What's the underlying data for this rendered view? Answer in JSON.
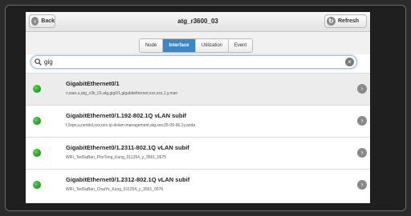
{
  "header": {
    "back_label": "Back",
    "title": "atg_r3600_03",
    "refresh_label": "Refresh"
  },
  "tabs": [
    {
      "label": "Node",
      "active": false
    },
    {
      "label": "Interface",
      "active": true
    },
    {
      "label": "Utilization",
      "active": false
    },
    {
      "label": "Event",
      "active": false
    }
  ],
  "search": {
    "value": "gig"
  },
  "interfaces": [
    {
      "name": "GigabitEthernet0/1",
      "description": "n,wan,u,atg_c3k_01,atg,gig0/1,gigabitethernet,xxx,xxx,1,y,man",
      "status": "up"
    },
    {
      "name": "GigabitEthernet0/1.192-802.1Q vLAN subif",
      "description": "f,0vpn,u,neodsl,xxx,nec-ip-dslam-management,atg,xxx,05-09-96,1y,anda",
      "status": "up"
    },
    {
      "name": "GigabitEthernet0/1.2311-802.1Q vLAN subif",
      "description": "WiFi_TedSaBan_PhoTong_Kung_011254_y_3561_0675",
      "status": "up"
    },
    {
      "name": "GigabitEthernet0/1.2312-802.1Q vLAN subif",
      "description": "WiFi_TedSaBan_ChaiYo_Kung_011254_y_3561_0676",
      "status": "up"
    }
  ],
  "colors": {
    "accent": "#3b87c8",
    "status_up": "#1faa1f"
  }
}
